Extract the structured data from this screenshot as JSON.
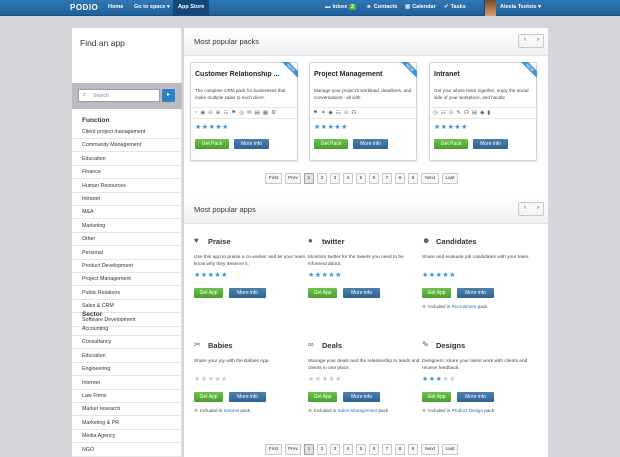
{
  "topbar": {
    "logo": "PODIO",
    "home": "Home",
    "goto": "Go to space",
    "appstore": "App Store",
    "inbox": "Inbox",
    "inbox_count": "2",
    "contacts": "Contacts",
    "calendar": "Calendar",
    "tasks": "Tasks",
    "user": "Alexia Tsotsis"
  },
  "sidebar": {
    "title": "Find an app",
    "search_placeholder": "Search",
    "function_head": "Function",
    "function_items": [
      "Client project management",
      "Community Management",
      "Education",
      "Finance",
      "Human Resources",
      "Intranet",
      "M&A",
      "Marketing",
      "Other",
      "Personal",
      "Product Development",
      "Project Management",
      "Public Relations",
      "Sales & CRM",
      "Software Development"
    ],
    "sector_head": "Sector",
    "sector_items": [
      "Accounting",
      "Consultancy",
      "Education",
      "Engineering",
      "Internet",
      "Law Firms",
      "Market research",
      "Marketing & PR",
      "Media Agency",
      "NGO"
    ]
  },
  "packs_section": {
    "title": "Most popular packs",
    "prev": "‹",
    "next": "›",
    "ribbon": "NEW",
    "get_label": "Get Pack",
    "info_label": "More info",
    "packs": [
      {
        "title": "Customer Relationship ...",
        "desc": "The complete CRM pack for businesses that make multiple sales to each client.",
        "icons": "◔ ◉ ⊙ ⊕ ☷ ⚑ ◎ ✉ ▤ ▦ ⚙",
        "rating": 5
      },
      {
        "title": "Project Management",
        "desc": "Manage your project's workload, deadlines, and conversations - all with",
        "icons": "⚑ ✦ ◆ ☷ ⊙ ☊",
        "rating": 5
      },
      {
        "title": "Intranet",
        "desc": "Get your whole team together, enjoy the social side of your workplace, and handle",
        "icons": "◷ ☷ ⊙ ✎ ☊ ▤ ◆ ▮",
        "rating": 5
      }
    ]
  },
  "pagination": {
    "first": "First",
    "prev": "Prev",
    "pages": [
      "1",
      "2",
      "3",
      "4",
      "5",
      "6",
      "7",
      "8",
      "9"
    ],
    "next": "Next",
    "last": "Last"
  },
  "apps_section": {
    "title": "Most popular apps",
    "prev": "‹",
    "next": "›",
    "get_label": "Get App",
    "info_label": "More info",
    "included_in": "Included in",
    "pack_word": "pack",
    "apps": [
      {
        "title": "Praise",
        "icon": "♥",
        "desc": "Use this app to praise a co-worker and let your team know why they deserve it.",
        "rating": 5,
        "included": ""
      },
      {
        "title": "twitter",
        "icon": "●",
        "desc": "Monitors twitter for the tweets you need to be informed about.",
        "rating": 5,
        "included": ""
      },
      {
        "title": "Candidates",
        "icon": "☻",
        "desc": "Share and evaluate job candidates with your team.",
        "rating": 5,
        "included": "Recruitment"
      },
      {
        "title": "Babies",
        "icon": "✂",
        "desc": "Share your joy with the Babies App.",
        "rating": 0,
        "included": "Intranet"
      },
      {
        "title": "Deals",
        "icon": "∞",
        "desc": "Manage your deals and the relationship to leads and clients in one place.",
        "rating": 0,
        "included": "Sales Management"
      },
      {
        "title": "Designs",
        "icon": "✎",
        "desc": "Designers; share your latest work with clients and receive feedback.",
        "rating": 3,
        "included": "Product Design"
      }
    ]
  }
}
